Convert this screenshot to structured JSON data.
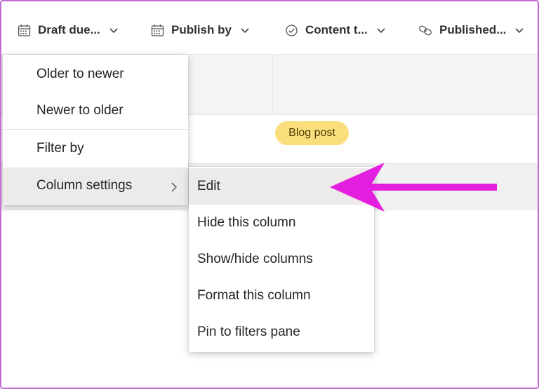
{
  "header": {
    "columns": [
      {
        "label": "Draft due...",
        "icon": "calendar-icon"
      },
      {
        "label": "Publish by",
        "icon": "calendar-icon"
      },
      {
        "label": "Content t...",
        "icon": "choice-circle-check-icon"
      },
      {
        "label": "Published...",
        "icon": "link-icon"
      }
    ]
  },
  "grid": {
    "tag": "Blog post"
  },
  "menu": {
    "items": [
      {
        "label": "Older to newer"
      },
      {
        "label": "Newer to older"
      },
      {
        "label": "Filter by"
      },
      {
        "label": "Column settings"
      }
    ]
  },
  "submenu": {
    "items": [
      {
        "label": "Edit"
      },
      {
        "label": "Hide this column"
      },
      {
        "label": "Show/hide columns"
      },
      {
        "label": "Format this column"
      },
      {
        "label": "Pin to filters pane"
      }
    ]
  },
  "colors": {
    "annotation_arrow": "#e51fe0",
    "tag_background": "#fbde7c",
    "frame_border": "#c36ad3"
  }
}
